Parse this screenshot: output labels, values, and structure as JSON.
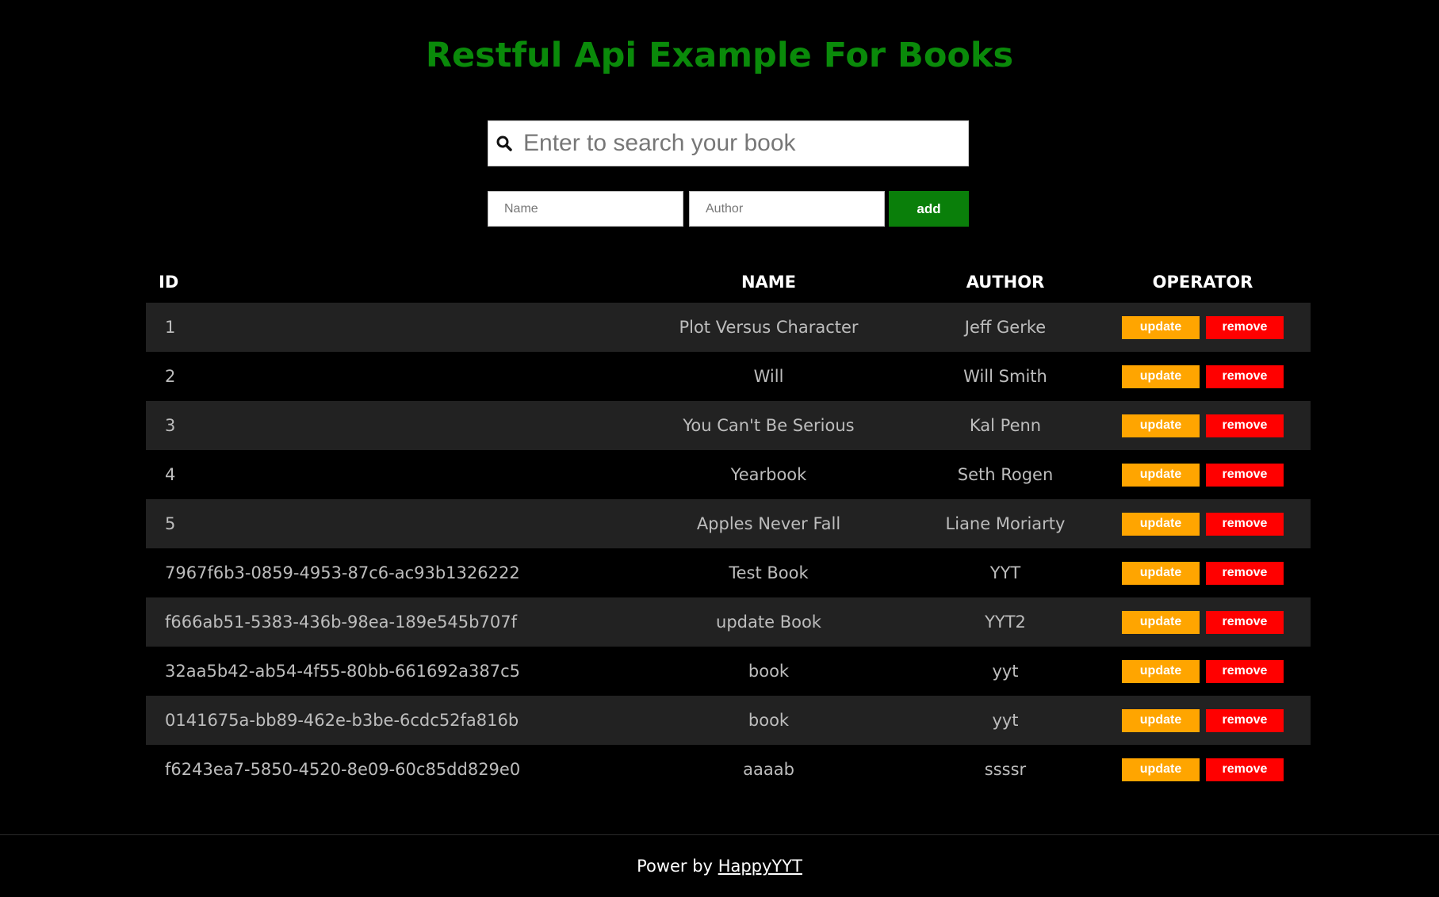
{
  "app": {
    "title": "Restful Api Example For Books"
  },
  "search": {
    "placeholder": "Enter to search your book",
    "value": "",
    "icon": "search-icon"
  },
  "add_form": {
    "name_placeholder": "Name",
    "author_placeholder": "Author",
    "add_label": "add",
    "add_color": "#0a7f0a"
  },
  "table": {
    "headers": {
      "id": "ID",
      "name": "NAME",
      "author": "AUTHOR",
      "operator": "OPERATOR"
    },
    "update_label": "update",
    "remove_label": "remove",
    "rows": [
      {
        "id": "1",
        "name": "Plot Versus Character",
        "author": "Jeff Gerke"
      },
      {
        "id": "2",
        "name": "Will",
        "author": "Will Smith"
      },
      {
        "id": "3",
        "name": "You Can't Be Serious",
        "author": "Kal Penn"
      },
      {
        "id": "4",
        "name": "Yearbook",
        "author": "Seth Rogen"
      },
      {
        "id": "5",
        "name": "Apples Never Fall",
        "author": "Liane Moriarty"
      },
      {
        "id": "7967f6b3-0859-4953-87c6-ac93b1326222",
        "name": "Test Book",
        "author": "YYT"
      },
      {
        "id": "f666ab51-5383-436b-98ea-189e545b707f",
        "name": "update Book",
        "author": "YYT2"
      },
      {
        "id": "32aa5b42-ab54-4f55-80bb-661692a387c5",
        "name": "book",
        "author": "yyt"
      },
      {
        "id": "0141675a-bb89-462e-b3be-6cdc52fa816b",
        "name": "book",
        "author": "yyt"
      },
      {
        "id": "f6243ea7-5850-4520-8e09-60c85dd829e0",
        "name": "aaaab",
        "author": "ssssr"
      }
    ]
  },
  "colors": {
    "title": "#0a8a0a",
    "update": "#ffa500",
    "remove": "#ff0000",
    "stripe": "#222222"
  },
  "footer": {
    "prefix": "Power by",
    "link_label": "HappyYYT"
  }
}
